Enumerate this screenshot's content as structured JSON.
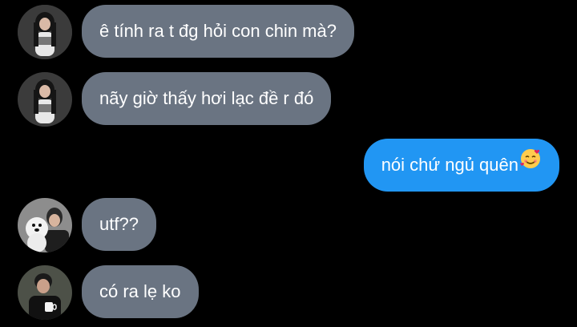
{
  "messages": [
    {
      "sender": "friend-1",
      "text": "ê tính ra t đg hỏi con chin mà?"
    },
    {
      "sender": "friend-1",
      "text": "nãy giờ thấy hơi lạc đề r đó"
    },
    {
      "sender": "me",
      "text": "nói chứ ngủ quên",
      "emoji": "smiling-face-with-hearts"
    },
    {
      "sender": "friend-2",
      "text": "utf??"
    },
    {
      "sender": "friend-3",
      "text": "có ra lẹ ko"
    }
  ],
  "colors": {
    "background": "#000000",
    "incoming_bubble": "#6a7482",
    "outgoing_bubble": "#2196f3",
    "text": "#ffffff"
  }
}
